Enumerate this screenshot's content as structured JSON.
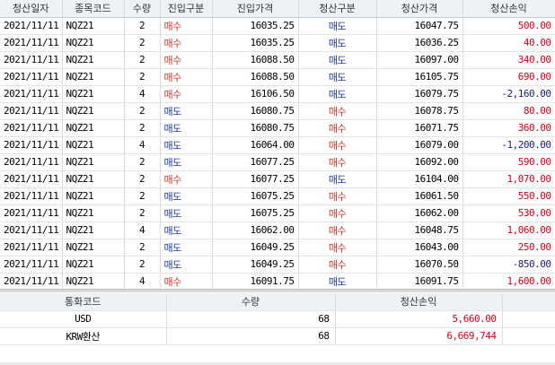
{
  "columns": [
    "청산일자",
    "종목코드",
    "수량",
    "진입구분",
    "진입가격",
    "청산구분",
    "청산가격",
    "청산손익"
  ],
  "rows": [
    {
      "date": "2021/11/11",
      "code": "NQZ21",
      "qty": "2",
      "entry_type": "매수",
      "entry_price": "16035.25",
      "exit_type": "매도",
      "exit_price": "16047.75",
      "pnl": "500.00",
      "pnl_sign": "pos"
    },
    {
      "date": "2021/11/11",
      "code": "NQZ21",
      "qty": "2",
      "entry_type": "매수",
      "entry_price": "16035.25",
      "exit_type": "매도",
      "exit_price": "16036.25",
      "pnl": "40.00",
      "pnl_sign": "pos"
    },
    {
      "date": "2021/11/11",
      "code": "NQZ21",
      "qty": "2",
      "entry_type": "매수",
      "entry_price": "16088.50",
      "exit_type": "매도",
      "exit_price": "16097.00",
      "pnl": "340.00",
      "pnl_sign": "pos"
    },
    {
      "date": "2021/11/11",
      "code": "NQZ21",
      "qty": "2",
      "entry_type": "매수",
      "entry_price": "16088.50",
      "exit_type": "매도",
      "exit_price": "16105.75",
      "pnl": "690.00",
      "pnl_sign": "pos"
    },
    {
      "date": "2021/11/11",
      "code": "NQZ21",
      "qty": "4",
      "entry_type": "매수",
      "entry_price": "16106.50",
      "exit_type": "매도",
      "exit_price": "16079.75",
      "pnl": "-2,160.00",
      "pnl_sign": "neg"
    },
    {
      "date": "2021/11/11",
      "code": "NQZ21",
      "qty": "2",
      "entry_type": "매도",
      "entry_price": "16080.75",
      "exit_type": "매수",
      "exit_price": "16078.75",
      "pnl": "80.00",
      "pnl_sign": "pos"
    },
    {
      "date": "2021/11/11",
      "code": "NQZ21",
      "qty": "2",
      "entry_type": "매도",
      "entry_price": "16080.75",
      "exit_type": "매수",
      "exit_price": "16071.75",
      "pnl": "360.00",
      "pnl_sign": "pos"
    },
    {
      "date": "2021/11/11",
      "code": "NQZ21",
      "qty": "4",
      "entry_type": "매도",
      "entry_price": "16064.00",
      "exit_type": "매수",
      "exit_price": "16079.00",
      "pnl": "-1,200.00",
      "pnl_sign": "neg"
    },
    {
      "date": "2021/11/11",
      "code": "NQZ21",
      "qty": "2",
      "entry_type": "매도",
      "entry_price": "16077.25",
      "exit_type": "매수",
      "exit_price": "16092.00",
      "pnl": "590.00",
      "pnl_sign": "pos"
    },
    {
      "date": "2021/11/11",
      "code": "NQZ21",
      "qty": "2",
      "entry_type": "매수",
      "entry_price": "16077.25",
      "exit_type": "매도",
      "exit_price": "16104.00",
      "pnl": "1,070.00",
      "pnl_sign": "pos"
    },
    {
      "date": "2021/11/11",
      "code": "NQZ21",
      "qty": "2",
      "entry_type": "매도",
      "entry_price": "16075.25",
      "exit_type": "매수",
      "exit_price": "16061.50",
      "pnl": "550.00",
      "pnl_sign": "pos"
    },
    {
      "date": "2021/11/11",
      "code": "NQZ21",
      "qty": "2",
      "entry_type": "매도",
      "entry_price": "16075.25",
      "exit_type": "매수",
      "exit_price": "16062.00",
      "pnl": "530.00",
      "pnl_sign": "pos"
    },
    {
      "date": "2021/11/11",
      "code": "NQZ21",
      "qty": "4",
      "entry_type": "매도",
      "entry_price": "16062.00",
      "exit_type": "매수",
      "exit_price": "16048.75",
      "pnl": "1,060.00",
      "pnl_sign": "pos"
    },
    {
      "date": "2021/11/11",
      "code": "NQZ21",
      "qty": "2",
      "entry_type": "매도",
      "entry_price": "16049.25",
      "exit_type": "매수",
      "exit_price": "16043.00",
      "pnl": "250.00",
      "pnl_sign": "pos"
    },
    {
      "date": "2021/11/11",
      "code": "NQZ21",
      "qty": "2",
      "entry_type": "매도",
      "entry_price": "16049.25",
      "exit_type": "매수",
      "exit_price": "16070.50",
      "pnl": "-850.00",
      "pnl_sign": "neg"
    },
    {
      "date": "2021/11/11",
      "code": "NQZ21",
      "qty": "4",
      "entry_type": "매수",
      "entry_price": "16091.75",
      "exit_type": "매도",
      "exit_price": "16091.75",
      "pnl": "1,600.00",
      "pnl_sign": "pos"
    }
  ],
  "summary": {
    "columns": [
      "통화코드",
      "수량",
      "청산손익"
    ],
    "rows": [
      {
        "currency": "USD",
        "qty": "68",
        "pnl": "5,660.00"
      },
      {
        "currency": "KRW환산",
        "qty": "68",
        "pnl": "6,669,744"
      }
    ]
  },
  "colors": {
    "buy": "#c0392b",
    "sell": "#1f3a93",
    "pnl_pos": "#d0021b",
    "pnl_neg": "#1a1a7a",
    "header_bg": "#eef2f7"
  }
}
